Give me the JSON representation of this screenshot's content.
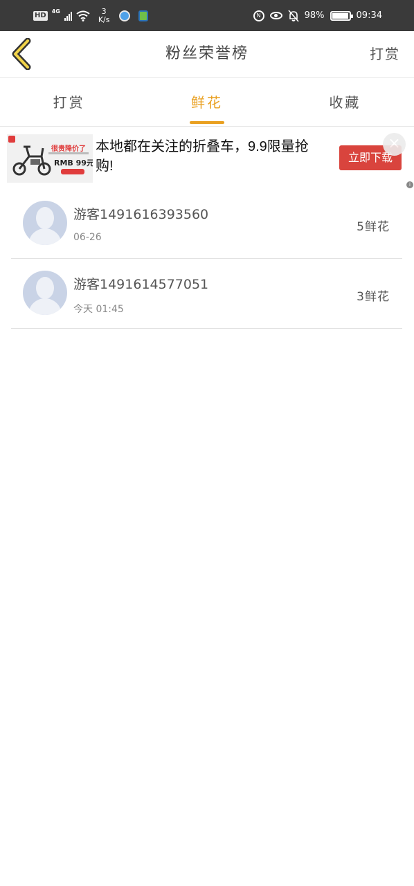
{
  "status_bar": {
    "hd": "HD",
    "network": "4G",
    "speed_value": "3",
    "speed_unit": "K/s",
    "nfc_label": "N",
    "battery": "98%",
    "time": "09:34"
  },
  "header": {
    "title": "粉丝荣誉榜",
    "action": "打赏"
  },
  "tabs": [
    {
      "label": "打赏",
      "active": false
    },
    {
      "label": "鲜花",
      "active": true
    },
    {
      "label": "收藏",
      "active": false
    }
  ],
  "ad": {
    "headline": "本地都在关注的折叠车，9.9限量抢购!",
    "image_headline": "很贵降价了",
    "image_price": "RMB 99元",
    "cta": "立即下载",
    "close": "×"
  },
  "fans": [
    {
      "name": "游客1491616393560",
      "time": "06-26",
      "amount": "5鲜花"
    },
    {
      "name": "游客1491614577051",
      "time": "今天 01:45",
      "amount": "3鲜花"
    }
  ],
  "colors": {
    "accent": "#e9a021",
    "ad_button": "#d9443d",
    "status_bar": "#3a3a3a"
  }
}
